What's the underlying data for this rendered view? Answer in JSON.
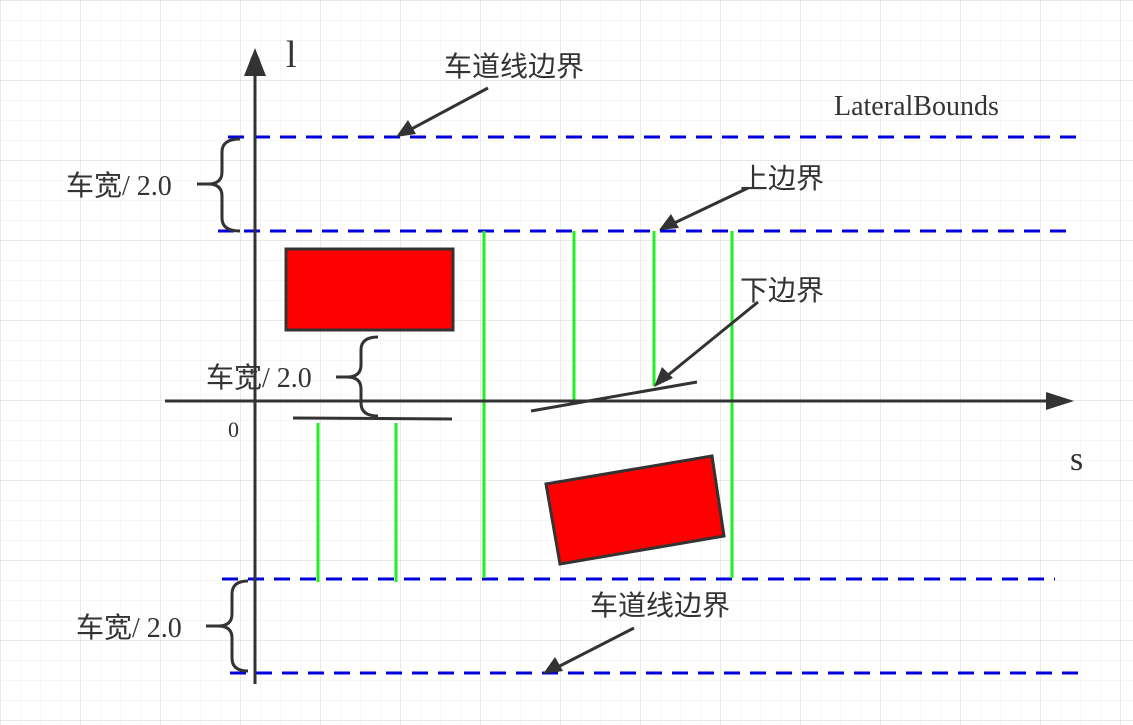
{
  "axes": {
    "l_label": "l",
    "s_label": "s",
    "origin_label": "0"
  },
  "labels": {
    "lane_boundary_top": "车道线边界",
    "lane_boundary_bottom": "车道线边界",
    "lateral_bounds": "LateralBounds",
    "upper_bound": "上边界",
    "lower_bound": "下边界",
    "half_width_top": "车宽/ 2.0",
    "half_width_mid": "车宽/ 2.0",
    "half_width_bottom": "车宽/ 2.0"
  },
  "colors": {
    "grid": "#e6e6e6",
    "axis": "#333333",
    "lane_dash": "#0000dd",
    "bound_line": "#22ee22",
    "obstacle_fill": "#ff0000",
    "obstacle_stroke": "#333333"
  }
}
